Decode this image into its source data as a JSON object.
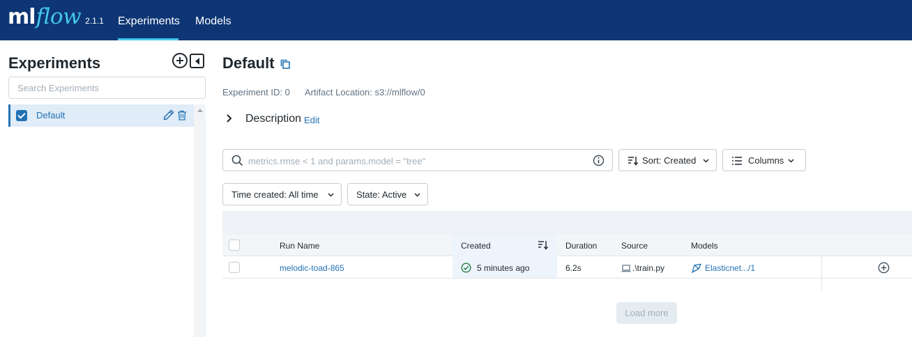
{
  "header": {
    "logo_ml": "ml",
    "logo_flow": "flow",
    "version": "2.1.1",
    "tabs": [
      {
        "label": "Experiments",
        "active": true
      },
      {
        "label": "Models",
        "active": false
      }
    ]
  },
  "sidebar": {
    "title": "Experiments",
    "search_placeholder": "Search Experiments",
    "items": [
      {
        "label": "Default",
        "checked": true
      }
    ]
  },
  "main": {
    "title": "Default",
    "experiment_id": "Experiment ID: 0",
    "artifact_location": "Artifact Location: s3://mlflow/0",
    "description_label": "Description",
    "description_edit": "Edit",
    "search_placeholder": "metrics.rmse < 1 and params.model = \"tree\"",
    "sort_label": "Sort: Created",
    "columns_label": "Columns",
    "time_filter": "Time created: All time",
    "state_filter": "State: Active",
    "load_more": "Load more"
  },
  "table": {
    "headers": [
      "Run Name",
      "Created",
      "Duration",
      "Source",
      "Models"
    ],
    "rows": [
      {
        "run_name": "melodic-toad-865",
        "created": "5 minutes ago",
        "duration": "6.2s",
        "source": ".\\train.py",
        "model": "Elasticnet.../1"
      }
    ]
  },
  "colors": {
    "header_bg": "#0e3675",
    "accent": "#43c9ed",
    "link": "#2272b4",
    "success": "#277c43"
  }
}
